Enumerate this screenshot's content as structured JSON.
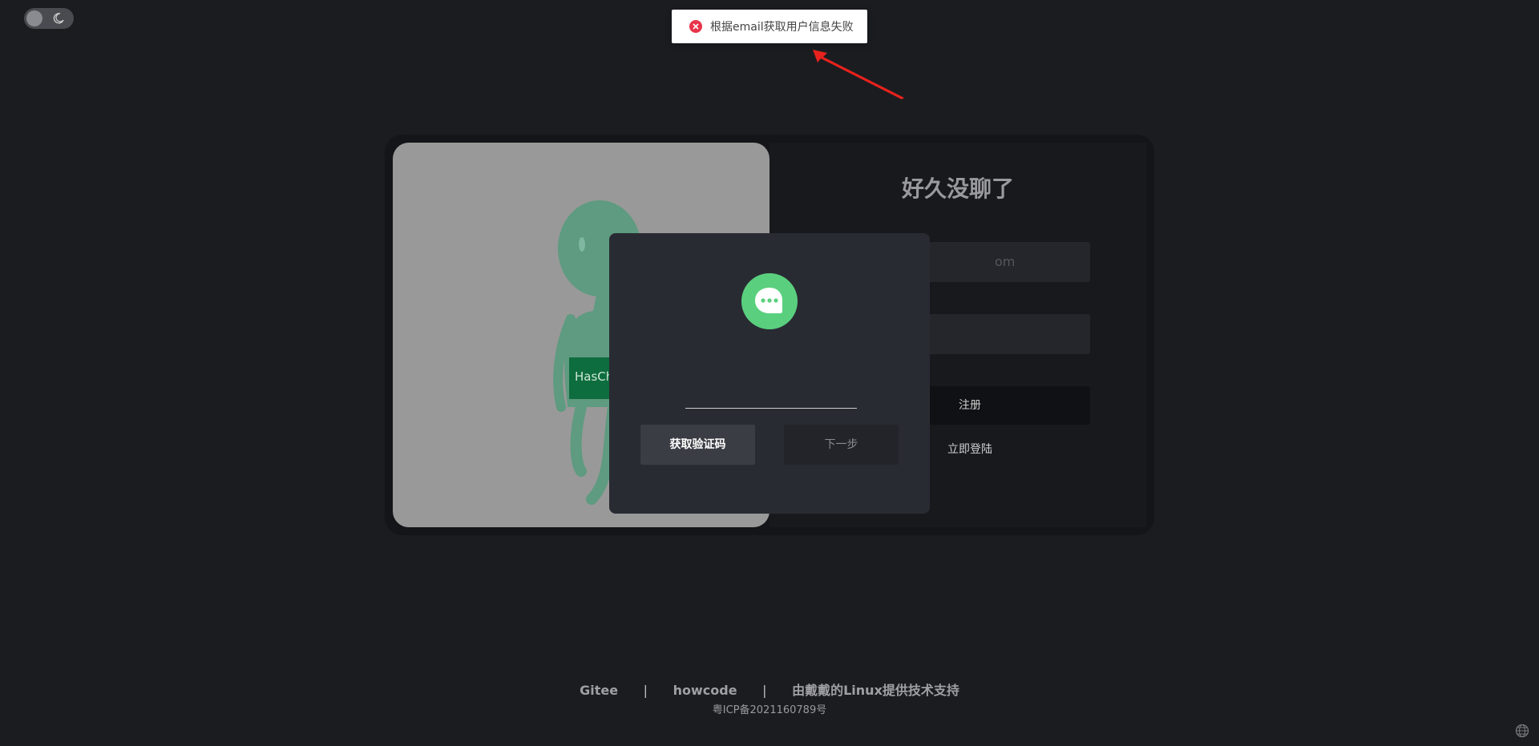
{
  "toast": {
    "message": "根据email获取用户信息失败",
    "type": "error"
  },
  "theme_toggle": {
    "icon": "moon-icon",
    "mode": "dark"
  },
  "illustration": {
    "badge_text": "HasCh"
  },
  "form": {
    "title": "好久没聊了",
    "email_placeholder": "om",
    "password_placeholder": "",
    "register_label": "注册",
    "login_link": "立即登陆"
  },
  "modal": {
    "logo_icon": "chat-bubble-icon",
    "code_value": "",
    "get_code_label": "获取验证码",
    "next_label": "下一步"
  },
  "footer": {
    "links": [
      "Gitee",
      "howcode",
      "由戴戴的Linux提供技术支持"
    ],
    "separator": "|",
    "icp": "粤ICP备2021160789号"
  },
  "colors": {
    "background": "#1b1c20",
    "accent_green": "#5ad07e",
    "error_red": "#e8334a"
  }
}
